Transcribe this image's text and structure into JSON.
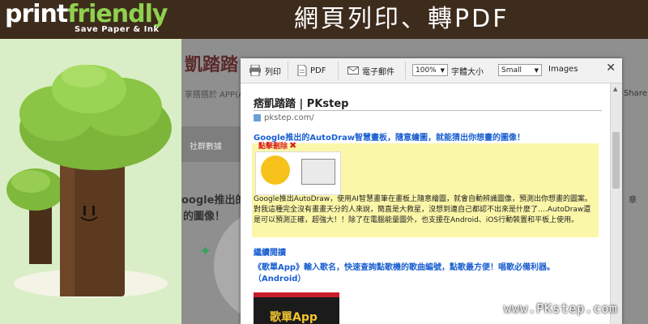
{
  "banner": {
    "logo_part1": "print",
    "logo_part2": "friendly",
    "tagline": "Save Paper & Ink",
    "headline": "網頁列印、轉PDF"
  },
  "background_page": {
    "title_fragment": "凱踏踏",
    "subtitle_fragment": "享搭搭於 APP(A",
    "nav_item": "社群數據",
    "body_line1": "oogle推出的",
    "body_line2": "的圖像！",
    "right_label": "Share",
    "right_label2": "章"
  },
  "toolbar": {
    "print_label": "列印",
    "pdf_label": "PDF",
    "email_label": "電子郵件",
    "zoom_value": "100%",
    "font_size_label": "字體大小",
    "image_size_value": "Small",
    "images_label": "Images",
    "close_glyph": "✕"
  },
  "article": {
    "site_title": "痞凱踏踏 | PKstep",
    "site_url": "pkstep.com/",
    "headline": "Google推出的AutoDraw智慧畫板，隨意繪圖，就能猜出你想畫的圖像！",
    "remove_label": "點擊刪除",
    "body": "Google推出AutoDraw，使用AI智慧畫筆在畫板上隨意繪圖，就會自動辨識圖像，預測出你想畫的圖案。對我這種完全沒有畫畫天分的人來說，簡直是大救星，沒想到連自己都認不出來是什麼了….AutoDraw還是可以預測正確，超強大！！除了在電腦能量圖外，也支援在Android、iOS行動裝置和平板上使用。",
    "read_more": "繼續閱讀",
    "second_headline": "《歌單App》輸入歌名，快速查詢點歌機的歌曲編號，點歌最方便！唱歌必備利器。（Android）",
    "thumb_caption": "歌單App"
  },
  "watermark": "www.PKstep.com",
  "colors": {
    "banner_bg": "#3d2b1c",
    "logo_green": "#8fd14f",
    "link_blue": "#1a5fd1",
    "highlight_yellow": "#fbf7a8",
    "panel_green": "#d9eec6"
  }
}
